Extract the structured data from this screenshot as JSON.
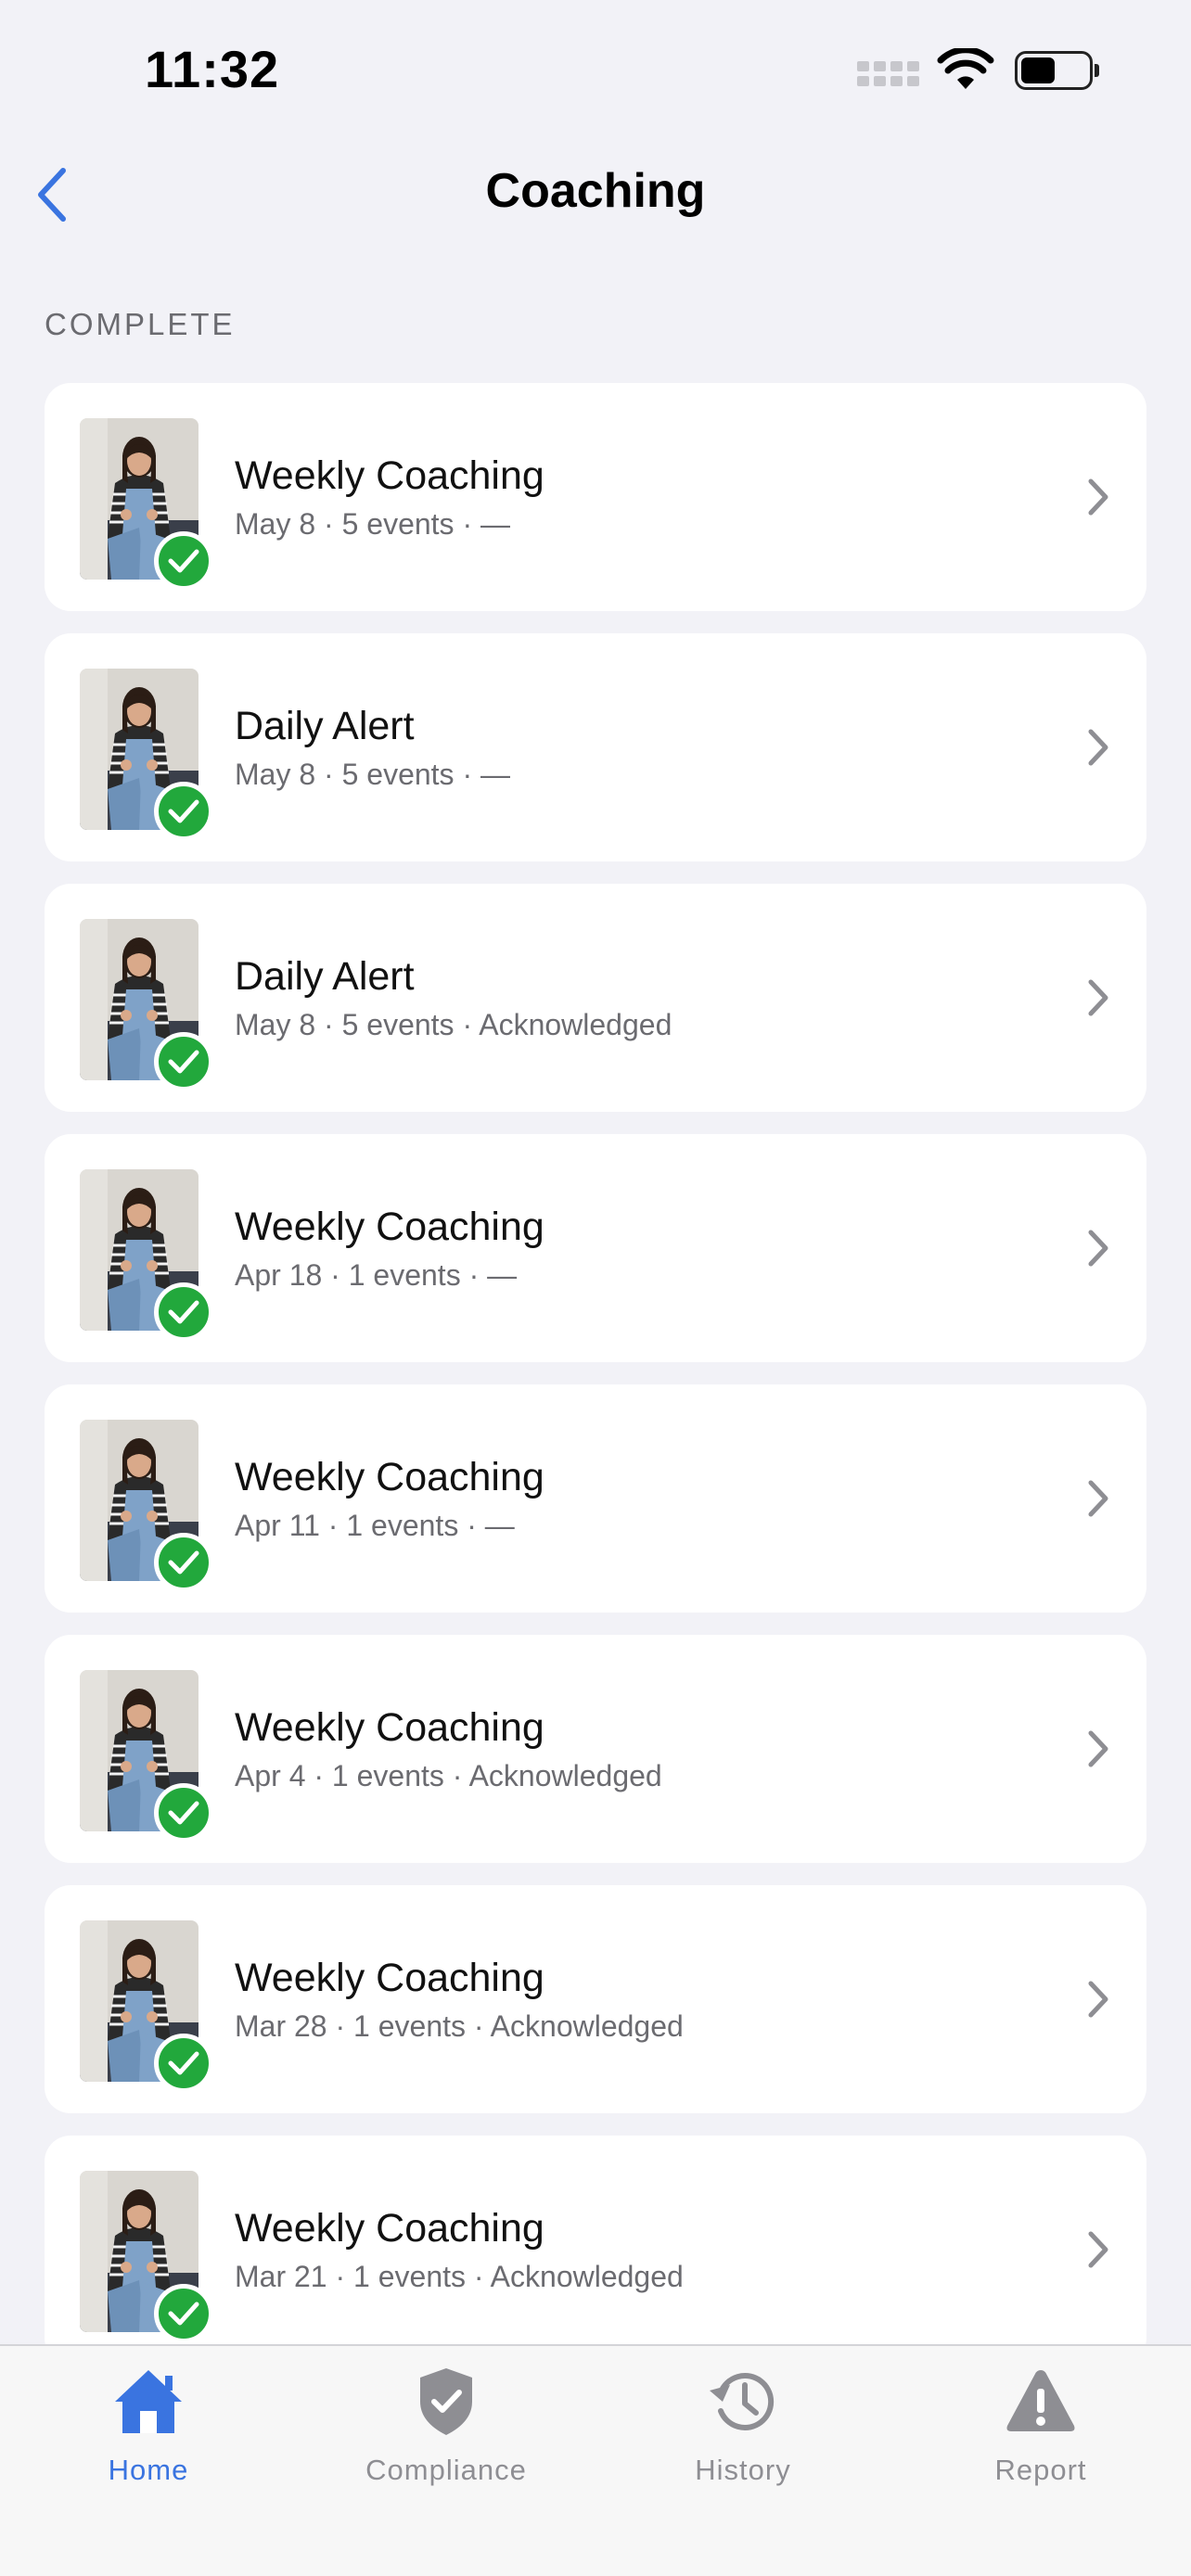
{
  "status_bar": {
    "time": "11:32"
  },
  "nav": {
    "title": "Coaching",
    "back_icon": "chevron-left-icon"
  },
  "section": {
    "header": "COMPLETE"
  },
  "items": [
    {
      "title": "Weekly Coaching",
      "subtitle": "May 8 · 5 events · —"
    },
    {
      "title": "Daily Alert",
      "subtitle": "May 8 · 5 events · —"
    },
    {
      "title": "Daily Alert",
      "subtitle": "May 8 · 5 events · Acknowledged"
    },
    {
      "title": "Weekly Coaching",
      "subtitle": "Apr 18 · 1 events · —"
    },
    {
      "title": "Weekly Coaching",
      "subtitle": "Apr 11 · 1 events · —"
    },
    {
      "title": "Weekly Coaching",
      "subtitle": "Apr 4 · 1 events · Acknowledged"
    },
    {
      "title": "Weekly Coaching",
      "subtitle": "Mar 28 · 1 events · Acknowledged"
    },
    {
      "title": "Weekly Coaching",
      "subtitle": "Mar 21 · 1 events · Acknowledged"
    }
  ],
  "tabs": [
    {
      "label": "Home",
      "icon": "home-icon",
      "active": true
    },
    {
      "label": "Compliance",
      "icon": "shield-check-icon",
      "active": false
    },
    {
      "label": "History",
      "icon": "history-icon",
      "active": false
    },
    {
      "label": "Report",
      "icon": "warning-icon",
      "active": false
    }
  ],
  "colors": {
    "accent": "#3a74e0",
    "success": "#22a83c",
    "background": "#f2f2f7",
    "inactive_tab": "#8e8e93"
  }
}
